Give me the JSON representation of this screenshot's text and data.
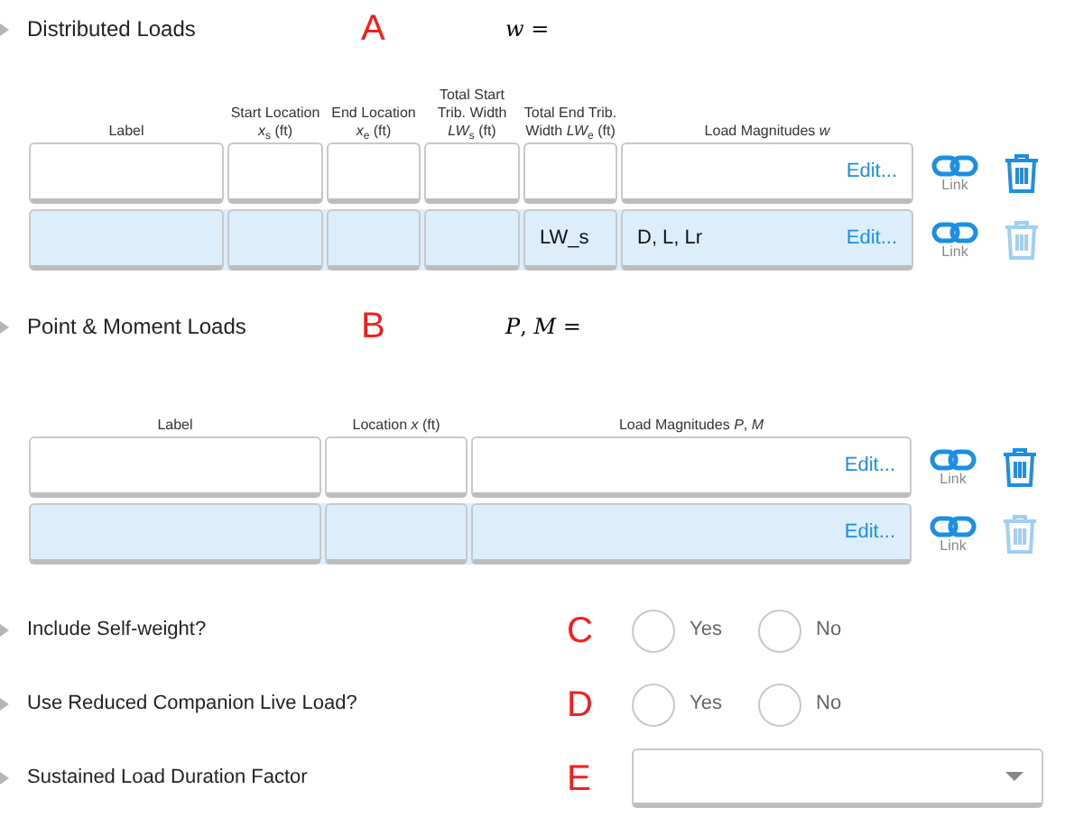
{
  "distributed_loads": {
    "title": "Distributed Loads",
    "marker": "A",
    "formula": "*w* =",
    "columns": [
      "Label",
      "Start Location *x*$_{s}$ (ft)",
      "End Location *x*$_{e}$ (ft)",
      "Total Start Trib. Width *LW*$_{s}$ (ft)",
      "Total End Trib. Width *LW*$_{e}$ (ft)",
      "Load Magnitudes *w*"
    ],
    "rows": [
      {
        "selected": false,
        "delete_disabled": false,
        "cells": [
          "",
          "",
          "",
          "",
          "",
          ""
        ],
        "edit": "Edit...",
        "link": "Link"
      },
      {
        "selected": true,
        "delete_disabled": true,
        "cells": [
          "",
          "",
          "",
          "",
          "LW_s",
          "D, L, Lr"
        ],
        "edit": "Edit...",
        "link": "Link"
      }
    ]
  },
  "point_moment_loads": {
    "title": "Point & Moment Loads",
    "marker": "B",
    "formula": "*P*, *M* =",
    "columns": [
      "Label",
      "Location *x* (ft)",
      "Load Magnitudes *P*, *M*"
    ],
    "rows": [
      {
        "selected": false,
        "delete_disabled": false,
        "cells": [
          "",
          "",
          ""
        ],
        "edit": "Edit...",
        "link": "Link"
      },
      {
        "selected": true,
        "delete_disabled": true,
        "cells": [
          "",
          "",
          ""
        ],
        "edit": "Edit...",
        "link": "Link"
      }
    ]
  },
  "options": [
    {
      "kind": "radio",
      "label": "Include Self-weight?",
      "marker": "C",
      "choices": [
        {
          "label": "Yes",
          "selected": false
        },
        {
          "label": "No",
          "selected": false
        }
      ]
    },
    {
      "kind": "radio",
      "label": "Use Reduced Companion Live Load?",
      "marker": "D",
      "choices": [
        {
          "label": "Yes",
          "selected": false
        },
        {
          "label": "No",
          "selected": false
        }
      ]
    },
    {
      "kind": "select",
      "label": "Sustained Load Duration Factor",
      "marker": "E"
    }
  ]
}
